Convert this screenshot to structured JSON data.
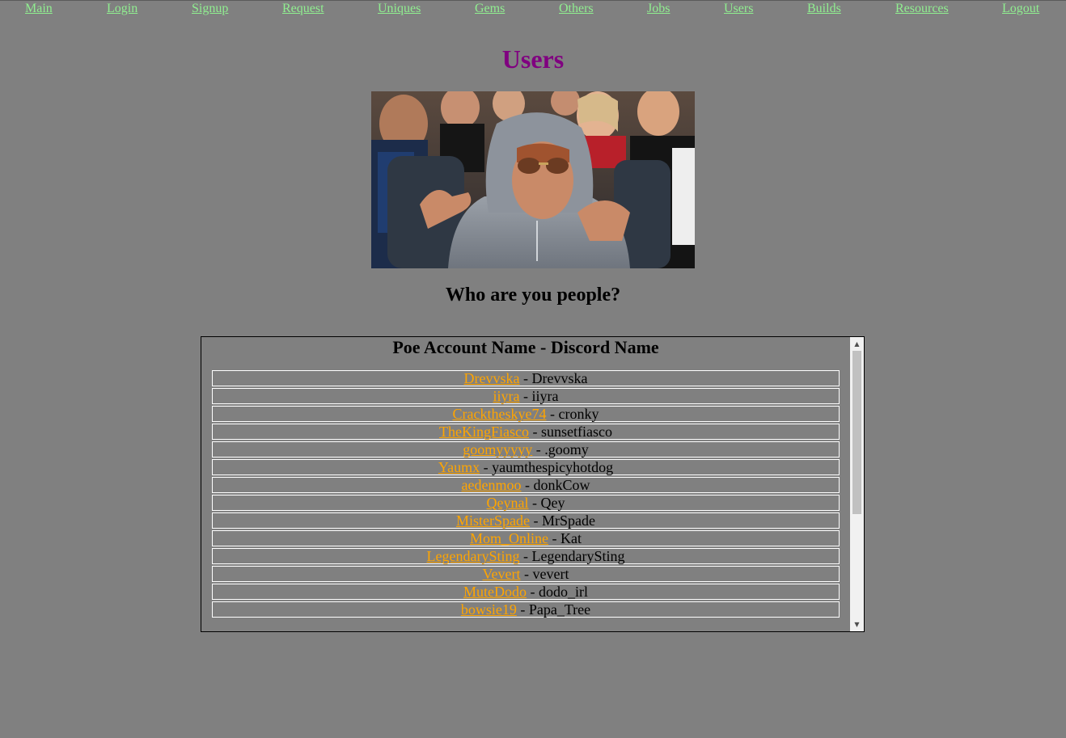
{
  "nav": {
    "items": [
      {
        "label": "Main"
      },
      {
        "label": "Login"
      },
      {
        "label": "Signup"
      },
      {
        "label": "Request"
      },
      {
        "label": "Uniques"
      },
      {
        "label": "Gems"
      },
      {
        "label": "Others"
      },
      {
        "label": "Jobs"
      },
      {
        "label": "Users"
      },
      {
        "label": "Builds"
      },
      {
        "label": "Resources"
      },
      {
        "label": "Logout"
      }
    ]
  },
  "page": {
    "title": "Users",
    "subtitle": "Who are you people?"
  },
  "users": {
    "header": "Poe Account Name - Discord Name",
    "rows": [
      {
        "account": "Drevvska",
        "discord": "Drevvska"
      },
      {
        "account": "iiyra",
        "discord": "iiyra"
      },
      {
        "account": "Cracktheskye74",
        "discord": "cronky"
      },
      {
        "account": "TheKingFiasco",
        "discord": "sunsetfiasco"
      },
      {
        "account": "goomyyyyy",
        "discord": ".goomy"
      },
      {
        "account": "Yaumx",
        "discord": "yaumthespicyhotdog"
      },
      {
        "account": "aedenmoo",
        "discord": "donkCow"
      },
      {
        "account": "Qeynal",
        "discord": "Qey"
      },
      {
        "account": "MisterSpade",
        "discord": "MrSpade"
      },
      {
        "account": "Mom_Online",
        "discord": "Kat"
      },
      {
        "account": "LegendarySting",
        "discord": "LegendarySting"
      },
      {
        "account": "Vevert",
        "discord": "vevert"
      },
      {
        "account": "MuteDodo",
        "discord": "dodo_irl"
      },
      {
        "account": "bowsie19",
        "discord": "Papa_Tree"
      }
    ]
  },
  "colors": {
    "background": "#808080",
    "nav_link": "#90ee90",
    "title": "#800080",
    "account_link": "#ffa500"
  },
  "icons": {
    "scroll_up": "triangle-up-icon",
    "scroll_down": "triangle-down-icon"
  }
}
